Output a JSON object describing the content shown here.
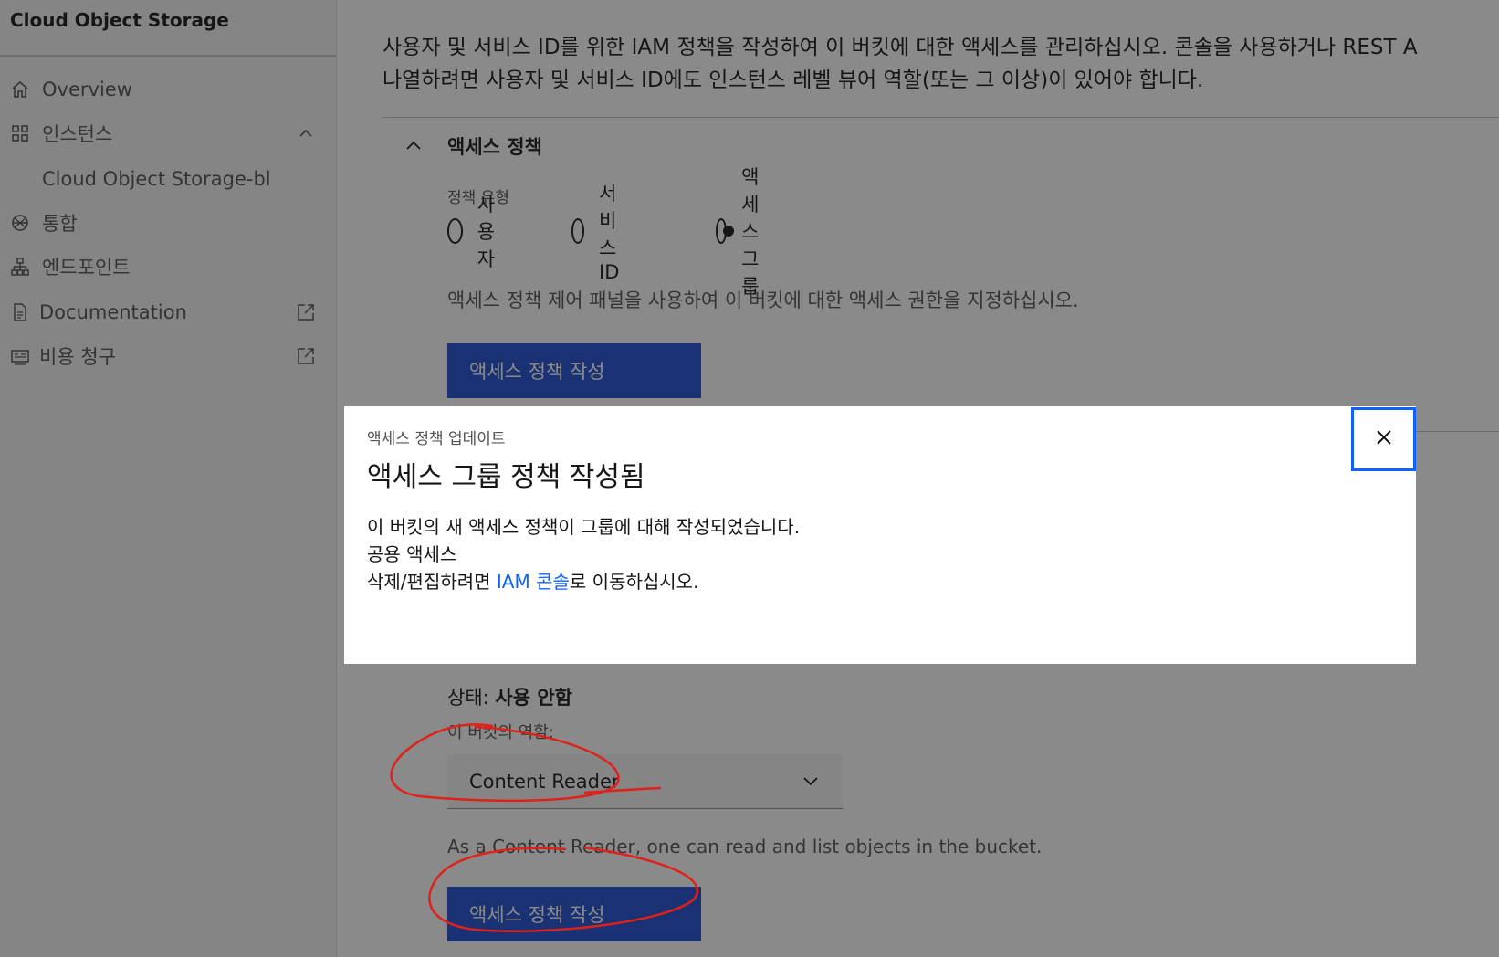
{
  "sidebar": {
    "brand": "Cloud Object Storage",
    "items": [
      {
        "label": "Overview",
        "icon": "home-icon"
      },
      {
        "label": "인스턴스",
        "icon": "grid-icon",
        "trail": "chevron-up-icon"
      },
      {
        "label": "Cloud Object Storage-bl"
      },
      {
        "label": "통합",
        "icon": "integration-icon"
      },
      {
        "label": "엔드포인트",
        "icon": "network-icon"
      },
      {
        "label": "Documentation",
        "icon": "document-icon",
        "trail": "launch-icon"
      },
      {
        "label": "비용 청구",
        "icon": "billing-icon",
        "trail": "launch-icon"
      }
    ]
  },
  "main": {
    "intro_line1": "사용자 및 서비스 ID를 위한 IAM 정책을 작성하여 이 버킷에 대한 액세스를 관리하십시오. 콘솔을 사용하거나 REST A",
    "intro_line2": "나열하려면 사용자 및 서비스 ID에도 인스턴스 레벨 뷰어 역할(또는 그 이상)이 있어야 합니다.",
    "access_policy": {
      "title": "액세스 정책",
      "policy_type_label": "정책 유형",
      "options": [
        {
          "label": "사용자",
          "selected": false
        },
        {
          "label": "서비스 ID",
          "selected": false
        },
        {
          "label": "액세스 그룹",
          "selected": true
        }
      ],
      "description": "액세스 정책 제어 패널을 사용하여 이 버킷에 대한 액세스 권한을 지정하십시오.",
      "create_button": "액세스 정책 작성"
    },
    "public_access": {
      "status_label": "상태:",
      "status_value": "사용 안함",
      "role_label": "이 버킷의 역할:",
      "role_selected": "Content Reader",
      "role_description": "As a Content Reader, one can read and list objects in the bucket.",
      "create_button": "액세스 정책 작성"
    }
  },
  "modal": {
    "label": "액세스 정책 업데이트",
    "title": "액세스 그룹 정책 작성됨",
    "body_line1": "이 버킷의 새 액세스 정책이 그룹에 대해 작성되었습니다.",
    "body_line2": "공용 액세스",
    "body_line3_prefix": "삭제/편집하려면 ",
    "body_link": "IAM 콘솔",
    "body_line3_suffix": "로 이동하십시오.",
    "close_icon": "close-icon"
  },
  "colors": {
    "primary": "#0f62fe",
    "annotation": "#e0201b"
  }
}
